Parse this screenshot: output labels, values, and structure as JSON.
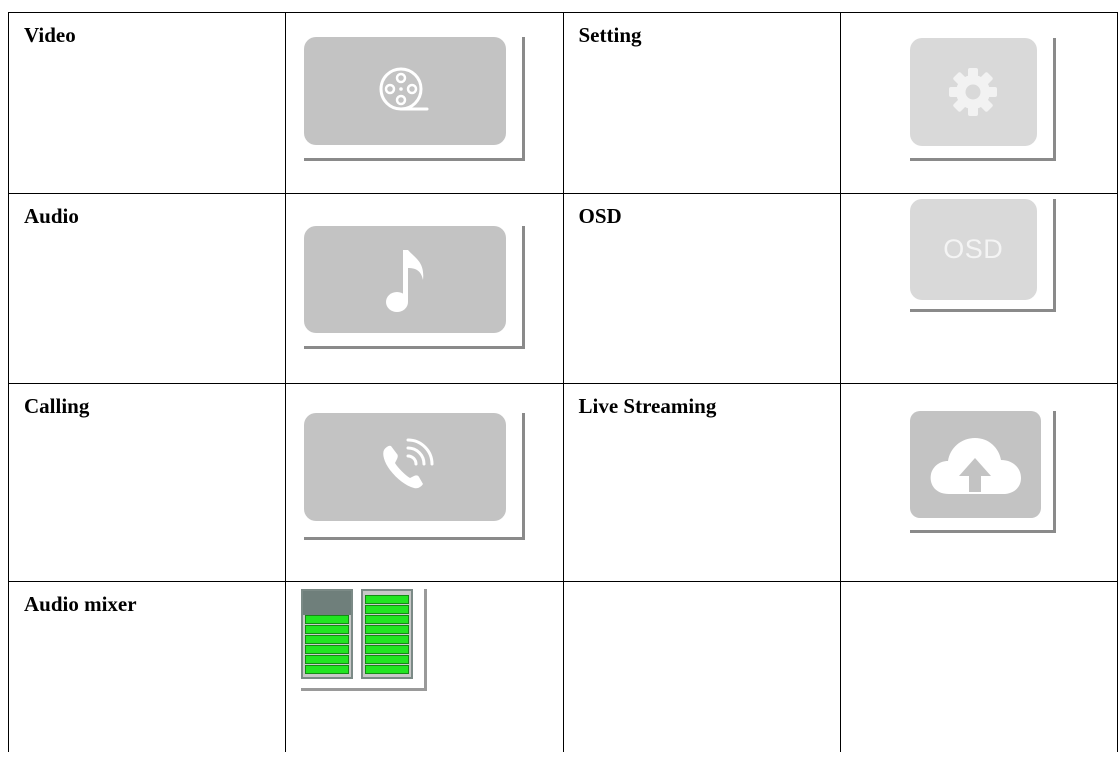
{
  "rows": [
    {
      "left": {
        "label": "Video",
        "icon": "film-reel-icon"
      },
      "right": {
        "label": "Setting",
        "icon": "gear-icon"
      }
    },
    {
      "left": {
        "label": "Audio",
        "icon": "music-note-icon"
      },
      "right": {
        "label": "OSD",
        "icon": "osd-icon",
        "icon_text": "OSD"
      }
    },
    {
      "left": {
        "label": "Calling",
        "icon": "phone-call-icon"
      },
      "right": {
        "label": "Live Streaming",
        "icon": "cloud-upload-icon"
      }
    },
    {
      "left": {
        "label": "Audio mixer",
        "icon": "audio-level-meter-icon"
      },
      "right": {
        "label": "",
        "icon": ""
      }
    }
  ],
  "colors": {
    "tile": "#c3c3c3",
    "tile_light": "#d9d9d9",
    "meter_green": "#21e521"
  },
  "mixer": {
    "left_level": 0.75,
    "right_level": 1.0
  }
}
